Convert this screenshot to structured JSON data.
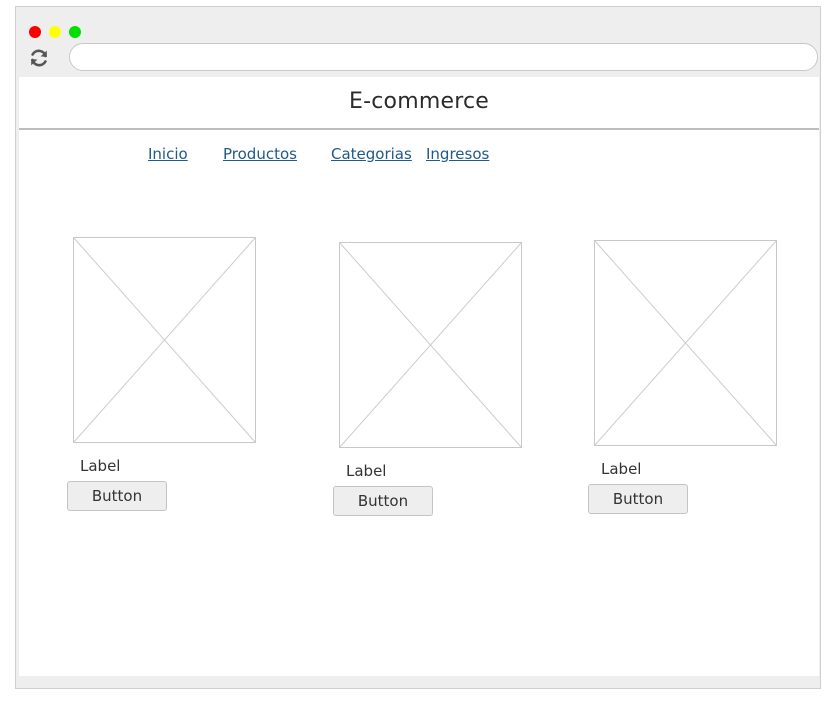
{
  "page": {
    "title": "E-commerce"
  },
  "window": {
    "controls": [
      {
        "name": "close",
        "color": "#ff0000"
      },
      {
        "name": "minimize",
        "color": "#ffff00"
      },
      {
        "name": "maximize",
        "color": "#00e000"
      }
    ],
    "reload_icon": "refresh-icon",
    "address_value": ""
  },
  "nav": {
    "items": [
      {
        "label": "Inicio"
      },
      {
        "label": "Productos"
      },
      {
        "label": "Categorias"
      },
      {
        "label": "Ingresos"
      }
    ],
    "link_color": "#1f5a88"
  },
  "products": [
    {
      "image_icon": "image-placeholder-icon",
      "label": "Label",
      "button_label": "Button"
    },
    {
      "image_icon": "image-placeholder-icon",
      "label": "Label",
      "button_label": "Button"
    },
    {
      "image_icon": "image-placeholder-icon",
      "label": "Label",
      "button_label": "Button"
    }
  ]
}
